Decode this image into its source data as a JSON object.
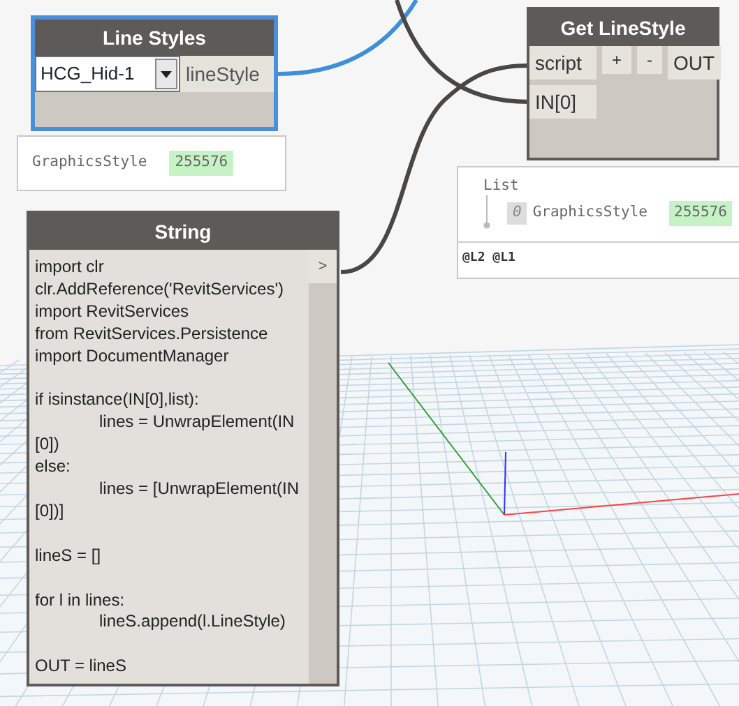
{
  "line_styles_node": {
    "title": "Line Styles",
    "selected": true,
    "dropdown_value": "HCG_Hid-1",
    "output": "lineStyle",
    "preview": {
      "type": "GraphicsStyle",
      "id": "255576"
    }
  },
  "python_node": {
    "title": "Get LineStyle",
    "selected": false,
    "inputs": [
      "script",
      "IN[0]"
    ],
    "add_input": "+",
    "remove_input": "-",
    "output": "OUT",
    "preview": {
      "label": "List",
      "items": [
        {
          "index": "0",
          "type": "GraphicsStyle",
          "id": "255576"
        }
      ],
      "levels": "@L2 @L1"
    }
  },
  "string_node": {
    "title": "String",
    "selected": false,
    "output": ">",
    "code_blocks": [
      [
        {
          "text": "import clr",
          "indent": false
        },
        {
          "text": "clr.AddReference('RevitServices')",
          "indent": false
        },
        {
          "text": "import RevitServices",
          "indent": false
        },
        {
          "text": "from RevitServices.Persistence",
          "indent": false
        },
        {
          "text": "import DocumentManager",
          "indent": false
        }
      ],
      [
        {
          "text": "if isinstance(IN[0],list):",
          "indent": false
        },
        {
          "text": "lines = UnwrapElement(IN",
          "indent": true
        },
        {
          "text": "[0])",
          "indent": false
        },
        {
          "text": "else:",
          "indent": false
        },
        {
          "text": "lines = [UnwrapElement(IN",
          "indent": true
        },
        {
          "text": "[0])]",
          "indent": false
        }
      ],
      [
        {
          "text": "lineS = []",
          "indent": false
        }
      ],
      [
        {
          "text": "for l in lines:",
          "indent": false
        },
        {
          "text": "lineS.append(l.LineStyle)",
          "indent": true
        }
      ],
      [
        {
          "text": "OUT = lineS",
          "indent": false
        }
      ]
    ]
  }
}
